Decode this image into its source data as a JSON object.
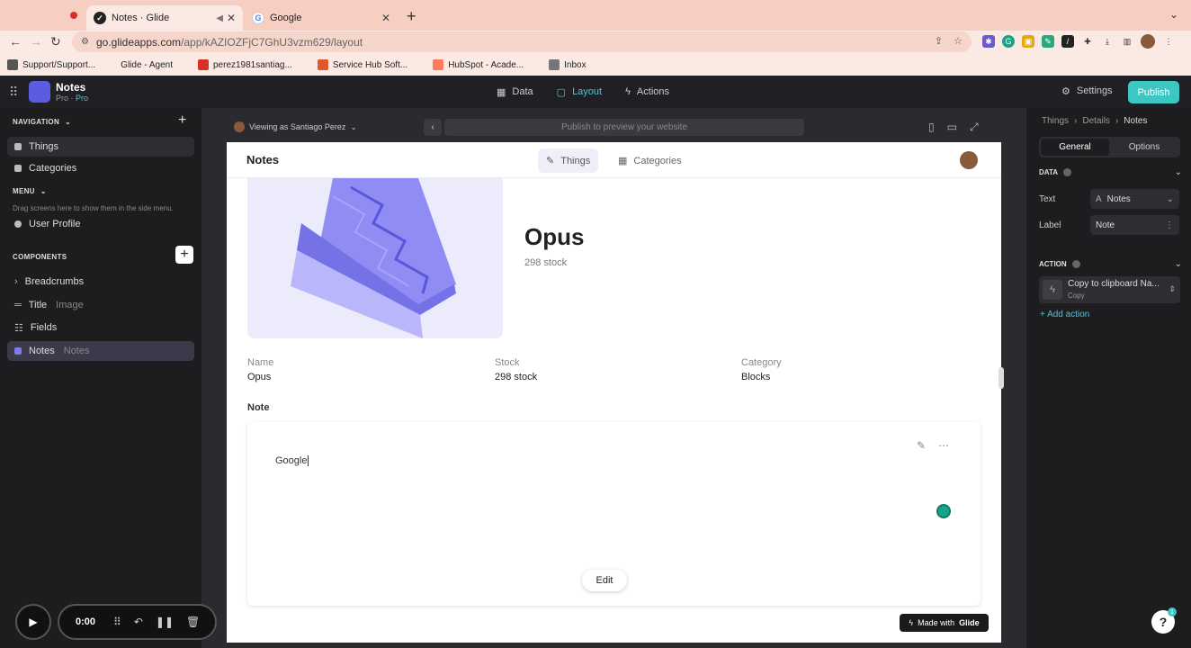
{
  "browser": {
    "tabs": [
      {
        "title": "Notes · Glide",
        "active": true
      },
      {
        "title": "Google",
        "active": false
      }
    ],
    "url_host": "go.glideapps.com",
    "url_path": "/app/kAZIOZFjC7GhU3vzm629/layout",
    "bookmarks": [
      "Support/Support...",
      "Glide - Agent",
      "perez1981santiag...",
      "Service Hub Soft...",
      "HubSpot - Acade...",
      "Inbox"
    ]
  },
  "glide": {
    "app_name": "Notes",
    "plan_prefix": "Pro · ",
    "plan_suffix": "Pro",
    "nav": [
      "Data",
      "Layout",
      "Actions"
    ],
    "settings_label": "Settings",
    "publish_label": "Publish"
  },
  "left": {
    "navigation_header": "NAVIGATION",
    "nav_items": [
      "Things",
      "Categories"
    ],
    "menu_header": "MENU",
    "menu_hint": "Drag screens here to show them in the side menu.",
    "menu_item": "User Profile",
    "components_header": "COMPONENTS",
    "components": [
      {
        "label": "Breadcrumbs",
        "sub": ""
      },
      {
        "label": "Title",
        "sub": "Image"
      },
      {
        "label": "Fields",
        "sub": ""
      },
      {
        "label": "Notes",
        "sub": "Notes"
      }
    ]
  },
  "preview": {
    "viewing_as": "Viewing as Santiago Perez",
    "url_placeholder": "Publish to preview your website"
  },
  "frame": {
    "title": "Notes",
    "tabs": [
      "Things",
      "Categories"
    ],
    "item_title": "Opus",
    "item_sub": "298 stock",
    "fields": [
      {
        "label": "Name",
        "value": "Opus"
      },
      {
        "label": "Stock",
        "value": "298 stock"
      },
      {
        "label": "Category",
        "value": "Blocks"
      }
    ],
    "note_label": "Note",
    "note_text": "Google",
    "edit_label": "Edit",
    "made_with": "Made with",
    "made_with_brand": "Glide"
  },
  "right": {
    "breadcrumbs": [
      "Things",
      "Details",
      "Notes"
    ],
    "seg": [
      "General",
      "Options"
    ],
    "data_header": "DATA",
    "text_label": "Text",
    "text_value": "Notes",
    "label_label": "Label",
    "label_value": "Note",
    "action_header": "ACTION",
    "action_title": "Copy to clipboard Na...",
    "action_sub": "Copy",
    "add_action": "+ Add action",
    "help_badge": "1"
  },
  "recorder": {
    "time": "0:00"
  }
}
